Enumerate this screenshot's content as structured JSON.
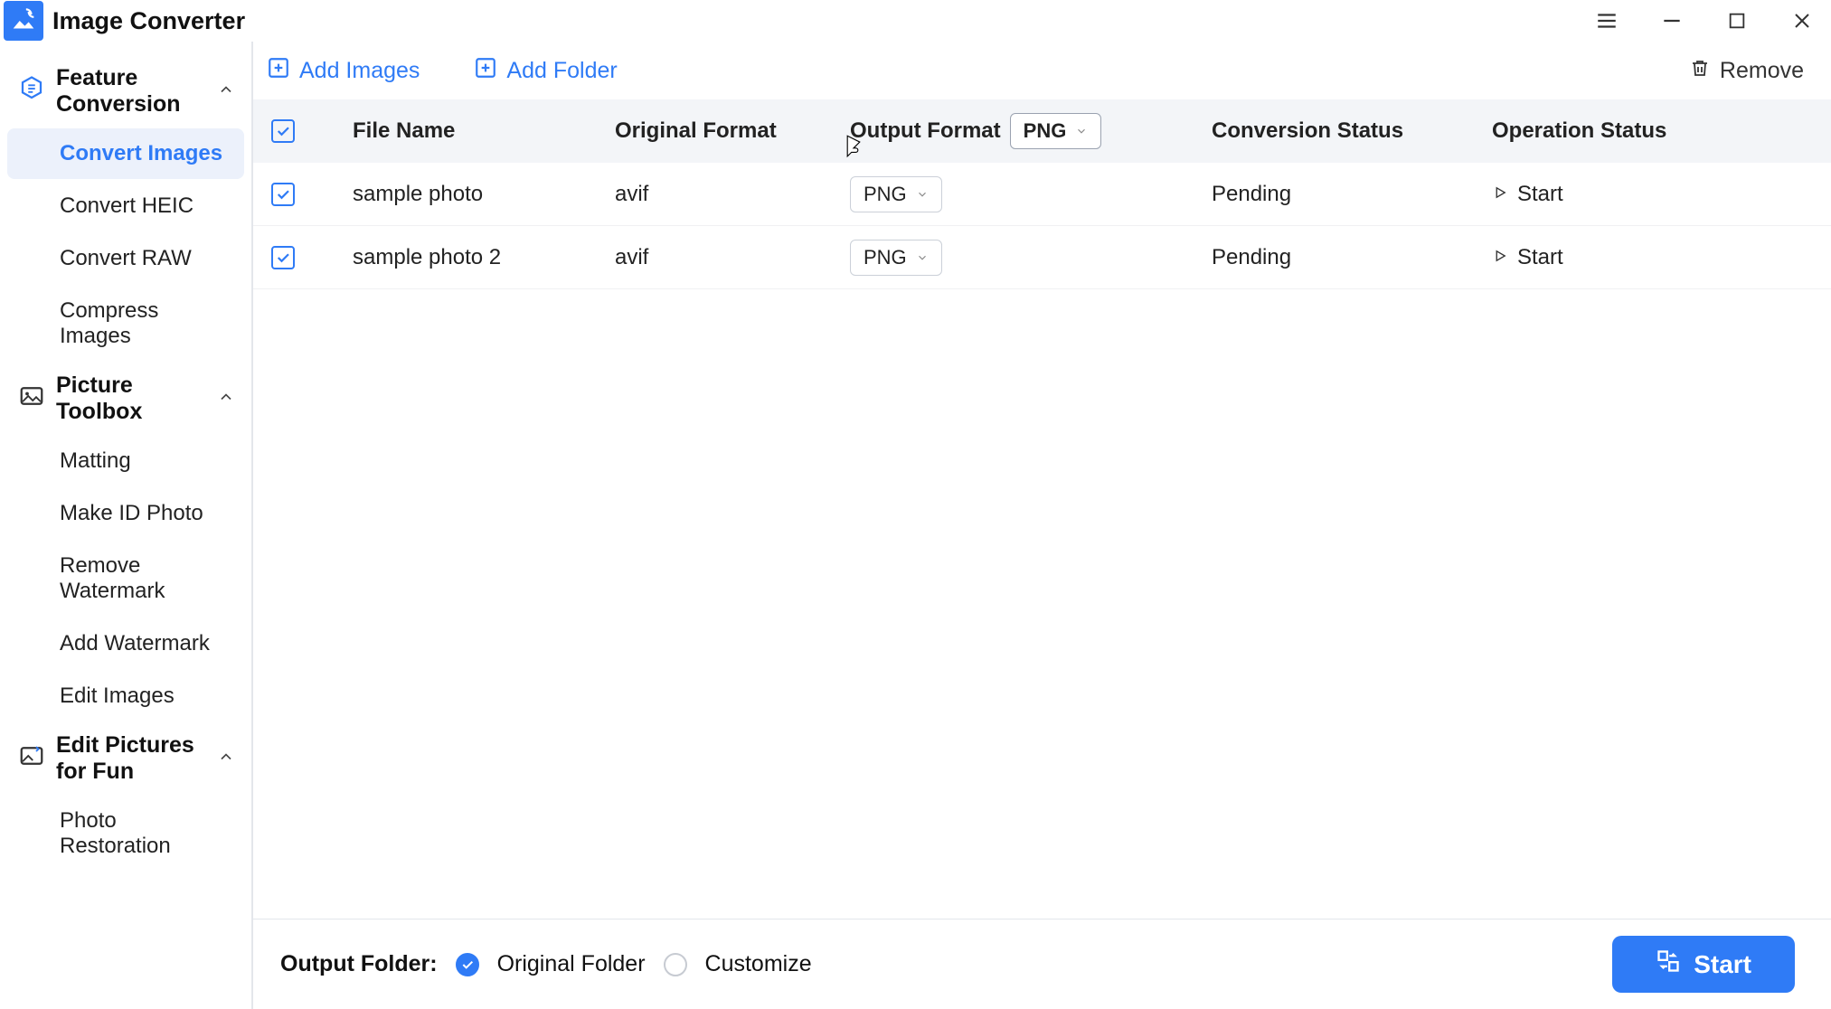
{
  "app": {
    "title": "Image Converter"
  },
  "sidebar": {
    "groups": [
      {
        "label": "Feature Conversion",
        "items": [
          {
            "label": "Convert Images",
            "active": true
          },
          {
            "label": "Convert HEIC"
          },
          {
            "label": "Convert RAW"
          },
          {
            "label": "Compress Images"
          }
        ]
      },
      {
        "label": "Picture Toolbox",
        "items": [
          {
            "label": "Matting"
          },
          {
            "label": "Make ID Photo"
          },
          {
            "label": "Remove Watermark"
          },
          {
            "label": "Add Watermark"
          },
          {
            "label": "Edit Images"
          }
        ]
      },
      {
        "label": "Edit Pictures for Fun",
        "items": [
          {
            "label": "Photo Restoration"
          }
        ]
      }
    ]
  },
  "toolbar": {
    "add_images": "Add Images",
    "add_folder": "Add Folder",
    "remove": "Remove"
  },
  "table": {
    "headers": {
      "file_name": "File Name",
      "original_format": "Original Format",
      "output_format": "Output Format",
      "header_format_value": "PNG",
      "conversion_status": "Conversion Status",
      "operation_status": "Operation Status"
    },
    "rows": [
      {
        "checked": true,
        "name": "sample photo",
        "orig": "avif",
        "out": "PNG",
        "status": "Pending",
        "op": "Start"
      },
      {
        "checked": true,
        "name": "sample photo 2",
        "orig": "avif",
        "out": "PNG",
        "status": "Pending",
        "op": "Start"
      }
    ]
  },
  "footer": {
    "label": "Output Folder:",
    "original": "Original Folder",
    "customize": "Customize",
    "start": "Start"
  }
}
